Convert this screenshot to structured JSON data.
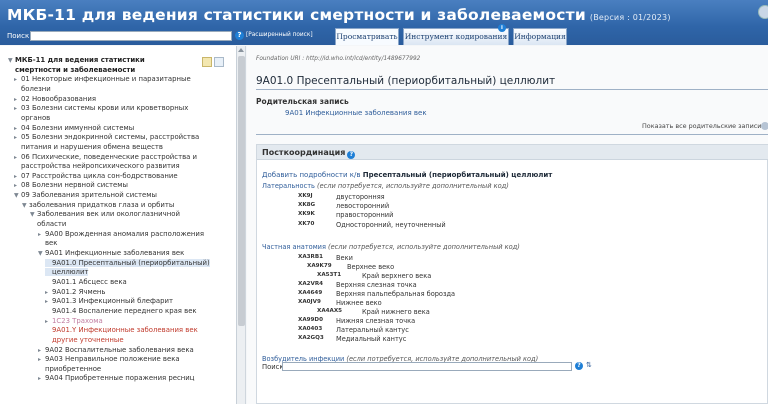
{
  "header": {
    "title": "МКБ-11 для ведения статистики смертности и заболеваемости",
    "version": "(Версия : 01/2023)",
    "search_label": "Поиск",
    "adv_search": "[Расширенный поиск]",
    "tabs": [
      {
        "label": "Просматривать"
      },
      {
        "label": "Инструмент кодирования"
      },
      {
        "label": "Информация"
      }
    ]
  },
  "tree": [
    {
      "label": "МКБ-11 для ведения статистики",
      "level": 0,
      "arrow": "▼",
      "style": "bold"
    },
    {
      "label": "смертности и заболеваемости",
      "level": 0,
      "arrow": "",
      "style": "bold"
    },
    {
      "label": "01 Некоторые инфекционные и паразитарные",
      "level": 1,
      "arrow": "▸",
      "style": ""
    },
    {
      "label": "болезни",
      "level": 1,
      "arrow": "",
      "style": ""
    },
    {
      "label": "02 Новообразования",
      "level": 1,
      "arrow": "▸",
      "style": ""
    },
    {
      "label": "03 Болезни системы крови или кроветворных",
      "level": 1,
      "arrow": "▸",
      "style": ""
    },
    {
      "label": "органов",
      "level": 1,
      "arrow": "",
      "style": ""
    },
    {
      "label": "04 Болезни иммунной системы",
      "level": 1,
      "arrow": "▸",
      "style": ""
    },
    {
      "label": "05 Болезни эндокринной системы, расстройства",
      "level": 1,
      "arrow": "▸",
      "style": ""
    },
    {
      "label": "питания и нарушения обмена веществ",
      "level": 1,
      "arrow": "",
      "style": ""
    },
    {
      "label": "06 Психические, поведенческие расстройства и",
      "level": 1,
      "arrow": "▸",
      "style": ""
    },
    {
      "label": "расстройства нейропсихического развития",
      "level": 1,
      "arrow": "",
      "style": ""
    },
    {
      "label": "07 Расстройства цикла сон-бодрствование",
      "level": 1,
      "arrow": "▸",
      "style": ""
    },
    {
      "label": "08 Болезни нервной системы",
      "level": 1,
      "arrow": "▸",
      "style": ""
    },
    {
      "label": "09 Заболевания зрительной системы",
      "level": 1,
      "arrow": "▼",
      "style": ""
    },
    {
      "label": "заболевания придатков глаза и орбиты",
      "level": 2,
      "arrow": "▼",
      "style": ""
    },
    {
      "label": "Заболевания век или окологлазничной",
      "level": 3,
      "arrow": "▼",
      "style": ""
    },
    {
      "label": "области",
      "level": 3,
      "arrow": "",
      "style": ""
    },
    {
      "label": "9A00 Врожденная аномалия расположения",
      "level": 4,
      "arrow": "▸",
      "style": ""
    },
    {
      "label": "век",
      "level": 4,
      "arrow": "",
      "style": ""
    },
    {
      "label": "9A01 Инфекционные заболевания век",
      "level": 4,
      "arrow": "▼",
      "style": ""
    },
    {
      "label": "9A01.0 Пресептальный (периорбитальный)",
      "level": 5,
      "arrow": "",
      "style": "sel"
    },
    {
      "label": "целлюлит",
      "level": 5,
      "arrow": "",
      "style": "sel"
    },
    {
      "label": "9A01.1 Абсцесс века",
      "level": 5,
      "arrow": "",
      "style": ""
    },
    {
      "label": "9A01.2 Ячмень",
      "level": 5,
      "arrow": "▸",
      "style": ""
    },
    {
      "label": "9A01.3 Инфекционный блефарит",
      "level": 5,
      "arrow": "▸",
      "style": ""
    },
    {
      "label": "9A01.4 Воспаление переднего края век",
      "level": 5,
      "arrow": "",
      "style": ""
    },
    {
      "label": "1C23 Трахома",
      "level": 5,
      "arrow": "▸",
      "style": "pink"
    },
    {
      "label": "9A01.Y Инфекционные заболевания век",
      "level": 5,
      "arrow": "",
      "style": "red"
    },
    {
      "label": "другие уточненные",
      "level": 5,
      "arrow": "",
      "style": "red"
    },
    {
      "label": "9A02 Воспалительные заболевания века",
      "level": 4,
      "arrow": "▸",
      "style": ""
    },
    {
      "label": "9A03 Неправильное положение века",
      "level": 4,
      "arrow": "▸",
      "style": ""
    },
    {
      "label": "приобретенное",
      "level": 4,
      "arrow": "",
      "style": ""
    },
    {
      "label": "9A04 Приобретенные поражения ресниц",
      "level": 4,
      "arrow": "▸",
      "style": ""
    }
  ],
  "detail": {
    "uri": "Foundation URI : http://id.who.int/icd/entity/1489677992",
    "title": "9A01.0 Пресептальный (периорбитальный) целлюлит",
    "parent_label": "Родительская запись",
    "parent_link": "9A01 Инфекционные заболевания век",
    "show_parents": "Показать все родительские записи"
  },
  "postcoord": {
    "title": "Посткоординация",
    "add_prefix": "Добавить подробности к/в",
    "add_entity": "Пресептальный (периорбитальный) целлюлит",
    "laterality": {
      "title": "Латеральность",
      "note": "(если потребуется, используйте дополнительный код)",
      "codes": [
        {
          "code": "XK9J",
          "label": "двусторонняя"
        },
        {
          "code": "XK8G",
          "label": "левосторонний"
        },
        {
          "code": "XK9K",
          "label": "правосторонний"
        },
        {
          "code": "XK70",
          "label": "Односторонний, неуточненный"
        }
      ]
    },
    "anatomy": {
      "title": "Частная анатомия",
      "note": "(если потребуется, используйте дополнительный код)",
      "codes": [
        {
          "code": "XA3RB1",
          "label": "Веки",
          "indent": 0
        },
        {
          "code": "XA9K79",
          "label": "Верхнее веко",
          "indent": 1
        },
        {
          "code": "XA53T1",
          "label": "Край верхнего века",
          "indent": 2
        },
        {
          "code": "XA2VR4",
          "label": "Верхняя слезная точка",
          "indent": 0
        },
        {
          "code": "XA4649",
          "label": "Верхняя пальпебральная борозда",
          "indent": 0
        },
        {
          "code": "XA0JV9",
          "label": "Нижнее веко",
          "indent": 0
        },
        {
          "code": "XA4AX5",
          "label": "Край нижнего века",
          "indent": 2
        },
        {
          "code": "XA99D0",
          "label": "Нижняя слезная точка",
          "indent": 0
        },
        {
          "code": "XA0403",
          "label": "Латеральный кантус",
          "indent": 0
        },
        {
          "code": "XA2GQ3",
          "label": "Медиальный кантус",
          "indent": 0
        }
      ]
    },
    "infectious": {
      "title": "Возбудитель инфекции",
      "note": "(если потребуется, используйте дополнительный код)"
    },
    "search_label": "Поиск",
    "sort_glyph": "⇅"
  }
}
